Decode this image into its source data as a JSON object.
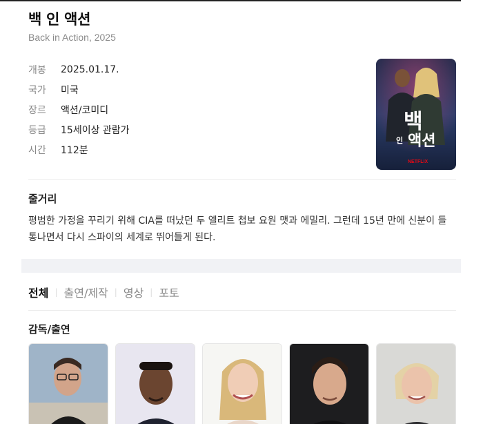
{
  "movie": {
    "title": "백 인 액션",
    "original_title": "Back in Action, 2025"
  },
  "info": [
    {
      "key": "개봉",
      "value": "2025.01.17."
    },
    {
      "key": "국가",
      "value": "미국"
    },
    {
      "key": "장르",
      "value": "액션/코미디"
    },
    {
      "key": "등급",
      "value": "15세이상 관람가"
    },
    {
      "key": "시간",
      "value": "112분"
    }
  ],
  "poster": {
    "title_big": "백",
    "title_mid": "인",
    "title_small": "액션",
    "brand": "NETFLIX"
  },
  "synopsis": {
    "heading": "줄거리",
    "text": "평범한 가정을 꾸리기 위해 CIA를 떠났던 두 엘리트 첩보 요원 맷과 에밀리. 그런데 15년 만에 신분이 들통나면서 다시 스파이의 세계로 뛰어들게 된다."
  },
  "tabs": [
    "전체",
    "출연/제작",
    "영상",
    "포토"
  ],
  "cast_section": {
    "heading": "감독/출연"
  },
  "colors": {
    "accent_text": "#111111",
    "muted": "#888888",
    "band": "#f1f2f5"
  }
}
